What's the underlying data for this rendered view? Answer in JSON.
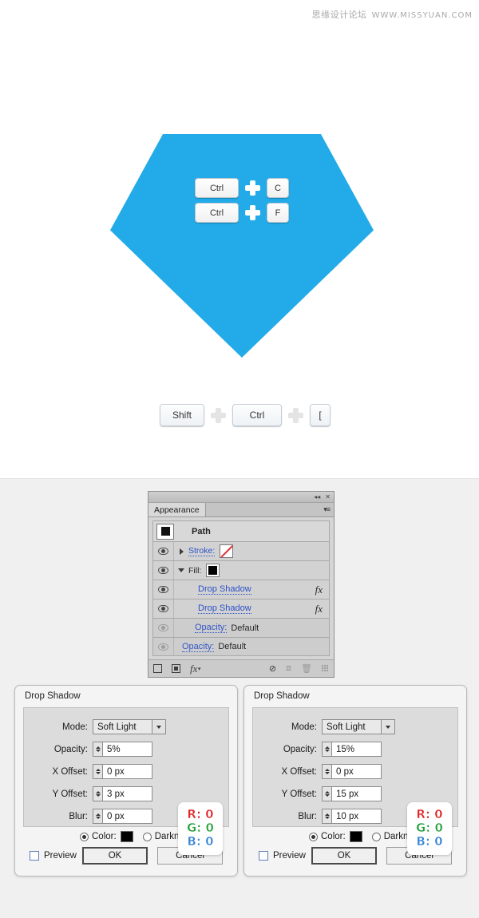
{
  "watermark": {
    "cn": "思缘设计论坛",
    "en": "WWW.MISSYUAN.COM"
  },
  "canvas": {
    "diamond_color": "#22abe8",
    "shortcuts_on_shape": [
      {
        "keys": [
          "Ctrl",
          "C"
        ],
        "separator": "+"
      },
      {
        "keys": [
          "Ctrl",
          "F"
        ],
        "separator": "+"
      }
    ],
    "shortcut_below": {
      "keys": [
        "Shift",
        "Ctrl",
        "["
      ],
      "separator": "+"
    }
  },
  "appearance_panel": {
    "tab_label": "Appearance",
    "titlebar": {
      "collapse_icon": "◂◂",
      "close_icon": "✕",
      "menu_icon": "▾≡"
    },
    "target_row": {
      "label": "Path",
      "swatch_color": "#111111"
    },
    "rows": [
      {
        "label": "Stroke:",
        "value": "",
        "type": "stroke",
        "visible": true,
        "disclosure": "right",
        "fx": false
      },
      {
        "label": "Fill:",
        "value": "",
        "type": "fill",
        "visible": true,
        "disclosure": "down",
        "fx": false
      },
      {
        "label": "Drop Shadow",
        "value": "",
        "type": "effect",
        "visible": true,
        "disclosure": "none",
        "fx": true
      },
      {
        "label": "Drop Shadow",
        "value": "",
        "type": "effect",
        "visible": true,
        "disclosure": "none",
        "fx": true
      },
      {
        "label": "Opacity:",
        "value": "Default",
        "type": "opacity",
        "visible": false,
        "disclosure": "none",
        "fx": false
      },
      {
        "label": "Opacity:",
        "value": "Default",
        "type": "opacity",
        "visible": false,
        "disclosure": "none",
        "fx": false
      }
    ],
    "toolbar": {
      "new_stroke": "new-stroke",
      "new_fill": "new-fill",
      "add_effect": "fx",
      "clear_appearance": "clear",
      "duplicate_item": "duplicate",
      "delete_item": "delete"
    }
  },
  "dialogs": [
    {
      "title": "Drop Shadow",
      "fields": {
        "mode_label": "Mode:",
        "mode_value": "Soft Light",
        "opacity_label": "Opacity:",
        "opacity_value": "5%",
        "x_offset_label": "X Offset:",
        "x_offset_value": "0 px",
        "y_offset_label": "Y Offset:",
        "y_offset_value": "3 px",
        "blur_label": "Blur:",
        "blur_value": "0 px",
        "color_label": "Color:",
        "darkness_label": "Darkness"
      },
      "rgb": {
        "r": "R: 0",
        "g": "G: 0",
        "b": "B: 0"
      },
      "footer": {
        "preview_label": "Preview",
        "ok_label": "OK",
        "cancel_label": "Cancel"
      }
    },
    {
      "title": "Drop Shadow",
      "fields": {
        "mode_label": "Mode:",
        "mode_value": "Soft Light",
        "opacity_label": "Opacity:",
        "opacity_value": "15%",
        "x_offset_label": "X Offset:",
        "x_offset_value": "0 px",
        "y_offset_label": "Y Offset:",
        "y_offset_value": "15 px",
        "blur_label": "Blur:",
        "blur_value": "10 px",
        "color_label": "Color:",
        "darkness_label": "Darkness"
      },
      "rgb": {
        "r": "R: 0",
        "g": "G: 0",
        "b": "B: 0"
      },
      "footer": {
        "preview_label": "Preview",
        "ok_label": "OK",
        "cancel_label": "Cancel"
      }
    }
  ]
}
